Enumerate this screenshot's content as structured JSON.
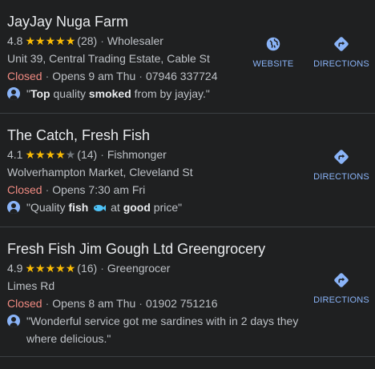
{
  "colors": {
    "star": "#fbbc04",
    "closed": "#f28b82",
    "link": "#8ab4f8"
  },
  "listings": [
    {
      "name": "JayJay Nuga Farm",
      "rating": "4.8",
      "stars_filled": 5,
      "review_count": "(28)",
      "category": "Wholesaler",
      "address": "Unit 39, Central Trading Estate, Cable St",
      "status": "Closed",
      "hours": "Opens 9 am Thu",
      "phone": "07946 337724",
      "review": {
        "q1": "\"",
        "b1": "Top",
        "t1": " quality ",
        "b2": "smoked",
        "t2": " from by jayjay.\""
      },
      "website_label": "WEBSITE",
      "directions_label": "DIRECTIONS"
    },
    {
      "name": "The Catch, Fresh Fish",
      "rating": "4.1",
      "stars_filled": 4,
      "review_count": "(14)",
      "category": "Fishmonger",
      "address": "Wolverhampton Market, Cleveland St",
      "status": "Closed",
      "hours": "Opens 7:30 am Fri",
      "review": {
        "q1": "\"Quality ",
        "b1": "fish",
        "t1": " at ",
        "b2": "good",
        "t2": " price\""
      },
      "directions_label": "DIRECTIONS"
    },
    {
      "name": "Fresh Fish Jim Gough Ltd Greengrocery",
      "rating": "4.9",
      "stars_filled": 5,
      "review_count": "(16)",
      "category": "Greengrocer",
      "address": "Limes Rd",
      "status": "Closed",
      "hours": "Opens 8 am Thu",
      "phone": "01902 751216",
      "review": {
        "text": "\"Wonderful service got me sardines with in 2 days they where delicious.\""
      },
      "directions_label": "DIRECTIONS"
    }
  ]
}
